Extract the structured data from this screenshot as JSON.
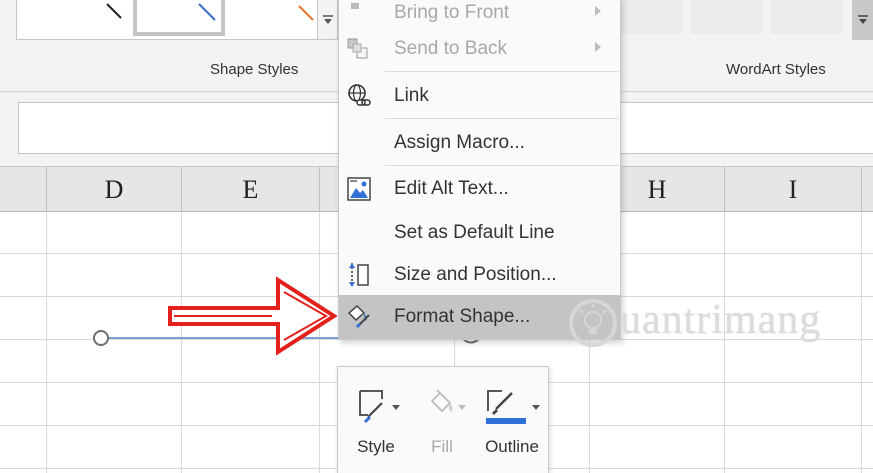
{
  "ribbon": {
    "shape_styles_label": "Shape Styles",
    "wordart_styles_label": "WordArt Styles"
  },
  "columns": [
    "D",
    "E",
    "H",
    "I"
  ],
  "context_menu": {
    "items": [
      {
        "label": "Bring to Front",
        "icon": "bring-to-front-icon",
        "state": "disabled",
        "submenu": true
      },
      {
        "label": "Send to Back",
        "icon": "send-to-back-icon",
        "state": "disabled",
        "submenu": true
      },
      {
        "label": "Link",
        "icon": "link-globe-icon",
        "state": "enabled",
        "submenu": false
      },
      {
        "label": "Assign Macro...",
        "icon": "",
        "state": "enabled",
        "submenu": false
      },
      {
        "label": "Edit Alt Text...",
        "icon": "alt-text-icon",
        "state": "enabled",
        "submenu": false
      },
      {
        "label": "Set as Default Line",
        "icon": "",
        "state": "enabled",
        "submenu": false
      },
      {
        "label": "Size and Position...",
        "icon": "size-position-icon",
        "state": "enabled",
        "submenu": false
      },
      {
        "label": "Format Shape...",
        "icon": "format-shape-icon",
        "state": "highlighted",
        "submenu": false
      }
    ]
  },
  "mini_toolbar": {
    "style_label": "Style",
    "fill_label": "Fill",
    "outline_label": "Outline"
  },
  "watermark": {
    "text": "uantrimang"
  },
  "colors": {
    "outline_accent": "#2f6fd6",
    "arrow_red": "#e3201b",
    "line_shape": "#7b9fd4"
  }
}
